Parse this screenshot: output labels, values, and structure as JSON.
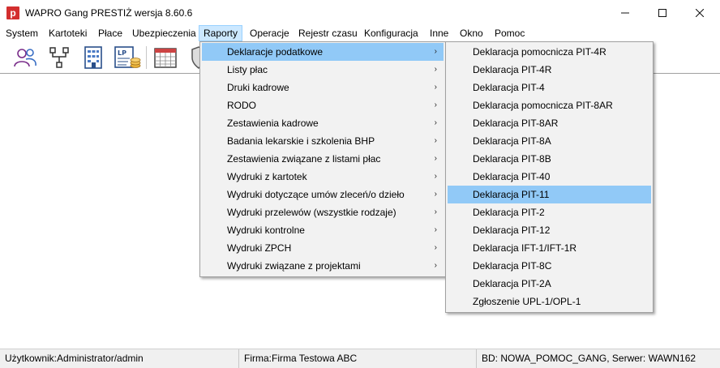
{
  "window": {
    "title": "WAPRO Gang PRESTIŻ wersja 8.60.6",
    "app_icon_letter": "p",
    "controls": {
      "minimize": "—",
      "maximize": "☐",
      "close": "✕"
    }
  },
  "menubar": {
    "items": [
      {
        "label": "System"
      },
      {
        "label": "Kartoteki"
      },
      {
        "label": "Płace"
      },
      {
        "label": "Ubezpieczenia"
      },
      {
        "label": "Raporty"
      },
      {
        "label": "Operacje"
      },
      {
        "label": "Rejestr czasu"
      },
      {
        "label": "Konfiguracja"
      },
      {
        "label": "Inne"
      },
      {
        "label": "Okno"
      },
      {
        "label": "Pomoc"
      }
    ],
    "active": "Raporty"
  },
  "toolbar": {
    "icons": [
      "users-icon",
      "org-tree-icon",
      "building-icon",
      "payroll-list-icon",
      "calendar-icon",
      "shield-icon"
    ],
    "payroll_badge": "LP"
  },
  "raporty_menu": {
    "items": [
      {
        "label": "Deklaracje podatkowe",
        "submenu": true
      },
      {
        "label": "Listy płac",
        "submenu": true
      },
      {
        "label": "Druki kadrowe",
        "submenu": true
      },
      {
        "label": "RODO",
        "submenu": true
      },
      {
        "label": "Zestawienia kadrowe",
        "submenu": true
      },
      {
        "label": "Badania lekarskie i szkolenia BHP",
        "submenu": true
      },
      {
        "label": "Zestawienia związane z listami płac",
        "submenu": true
      },
      {
        "label": "Wydruki z kartotek",
        "submenu": true
      },
      {
        "label": "Wydruki dotyczące umów zleceń/o dzieło",
        "submenu": true
      },
      {
        "label": "Wydruki przelewów (wszystkie rodzaje)",
        "submenu": true
      },
      {
        "label": "Wydruki kontrolne",
        "submenu": true
      },
      {
        "label": "Wydruki ZPCH",
        "submenu": true
      },
      {
        "label": "Wydruki związane z projektami",
        "submenu": true
      }
    ],
    "highlighted": "Deklaracje podatkowe",
    "arrow_glyph": "›"
  },
  "deklaracje_submenu": {
    "items": [
      {
        "label": "Deklaracja pomocnicza PIT-4R"
      },
      {
        "label": "Deklaracja PIT-4R"
      },
      {
        "label": "Deklaracja PIT-4"
      },
      {
        "label": "Deklaracja pomocnicza PIT-8AR"
      },
      {
        "label": "Deklaracja PIT-8AR"
      },
      {
        "label": "Deklaracja PIT-8A"
      },
      {
        "label": "Deklaracja PIT-8B"
      },
      {
        "label": "Deklaracja PIT-40"
      },
      {
        "label": "Deklaracja PIT-11"
      },
      {
        "label": "Deklaracja PIT-2"
      },
      {
        "label": "Deklaracja PIT-12"
      },
      {
        "label": "Deklaracja IFT-1/IFT-1R"
      },
      {
        "label": "Deklaracja PIT-8C"
      },
      {
        "label": "Deklaracja PIT-2A"
      },
      {
        "label": "Zgłoszenie UPL-1/OPL-1"
      }
    ],
    "highlighted": "Deklaracja PIT-11"
  },
  "statusbar": {
    "user": "Użytkownik:Administrator/admin",
    "company": "Firma:Firma Testowa ABC",
    "database": "BD: NOWA_POMOC_GANG, Serwer: WAWN162"
  },
  "colors": {
    "menu_highlight": "#91c9f7",
    "menubar_active": "#cce8ff",
    "app_icon": "#d32f2f",
    "statusbar_bg": "#f0f0f0",
    "dropdown_bg": "#f2f2f2"
  }
}
